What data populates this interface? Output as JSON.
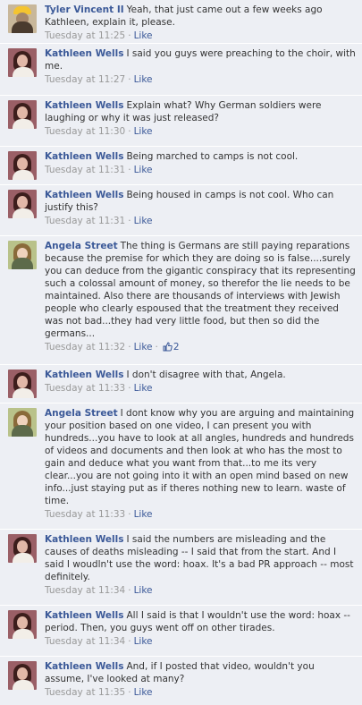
{
  "comments": [
    {
      "author": "Tyler Vincent II",
      "avatar": "hardhat-avatar",
      "text": "Yeah, that just came out a few weeks ago Kathleen, explain it, please.",
      "time": "Tuesday at 11:25",
      "like_label": "Like"
    },
    {
      "author": "Kathleen Wells",
      "avatar": "woman-dark-hair-avatar",
      "text": "I said you guys were preaching to the choir, with me.",
      "time": "Tuesday at 11:27",
      "like_label": "Like"
    },
    {
      "author": "Kathleen Wells",
      "avatar": "woman-dark-hair-avatar",
      "text": "Explain what? Why German soldiers were laughing or why it was just released?",
      "time": "Tuesday at 11:30",
      "like_label": "Like"
    },
    {
      "author": "Kathleen Wells",
      "avatar": "woman-dark-hair-avatar",
      "text": "Being marched to camps is not cool.",
      "time": "Tuesday at 11:31",
      "like_label": "Like"
    },
    {
      "author": "Kathleen Wells",
      "avatar": "woman-dark-hair-avatar",
      "text": "Being housed in camps is not cool. Who can justify this?",
      "time": "Tuesday at 11:31",
      "like_label": "Like"
    },
    {
      "author": "Angela Street",
      "avatar": "woman-light-hair-avatar",
      "text": "The thing is Germans are still paying reparations because the premise for which they are doing so is false....surely you can deduce from the gigantic conspiracy that its representing such a colossal amount of money, so therefor the lie needs to be maintained. Also there are thousands of interviews with Jewish people who clearly espoused that the treatment they received was not bad...they had very little food, but then so did the germans...",
      "time": "Tuesday at 11:32",
      "like_label": "Like",
      "likes_count": "2"
    },
    {
      "author": "Kathleen Wells",
      "avatar": "woman-dark-hair-avatar",
      "text": "I don't disagree with that, Angela.",
      "time": "Tuesday at 11:33",
      "like_label": "Like"
    },
    {
      "author": "Angela Street",
      "avatar": "woman-light-hair-avatar",
      "text": "I dont know why you are arguing and maintaining your position based on one video, I can present you with hundreds...you have to look at all angles, hundreds and hundreds of videos and documents and then look at who has the most to gain and deduce what you want from that...to me its very clear...you are not going into it with an open mind based on new info...just staying put as if theres nothing new to learn. waste of time.",
      "time": "Tuesday at 11:33",
      "like_label": "Like"
    },
    {
      "author": "Kathleen Wells",
      "avatar": "woman-dark-hair-avatar",
      "text": "I said the numbers are misleading and the causes of deaths misleading -- I said that from the start. And I said I woudln't use the word: hoax. It's a bad PR approach -- most definitely.",
      "time": "Tuesday at 11:34",
      "like_label": "Like"
    },
    {
      "author": "Kathleen Wells",
      "avatar": "woman-dark-hair-avatar",
      "text": "All I said is that I wouldn't use the word: hoax -- period. Then, you guys went off on other tirades.",
      "time": "Tuesday at 11:34",
      "like_label": "Like"
    },
    {
      "author": "Kathleen Wells",
      "avatar": "woman-dark-hair-avatar",
      "text": "And, if I posted that video, wouldn't you assume, I've looked at many?",
      "time": "Tuesday at 11:35",
      "like_label": "Like"
    }
  ],
  "colors": {
    "link": "#3b5998",
    "comment_bg": "#edeff4",
    "meta": "#999999"
  }
}
